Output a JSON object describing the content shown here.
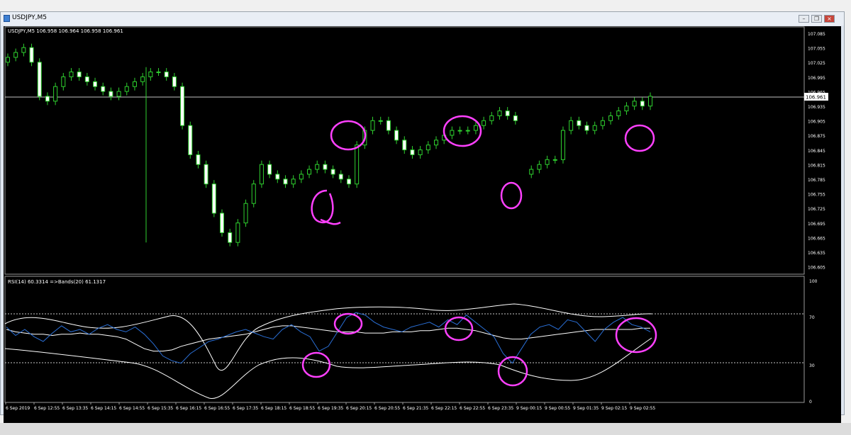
{
  "window": {
    "title": "USDJPY,M5",
    "buttons": [
      "minimize",
      "restore",
      "close"
    ]
  },
  "main_panel": {
    "header": "USDJPY,M5  106.958 106.964 106.958 106.961",
    "price_label": "106.961",
    "price_ticks": [
      "107.085",
      "107.055",
      "107.025",
      "106.995",
      "106.965",
      "106.935",
      "106.905",
      "106.875",
      "106.845",
      "106.815",
      "106.785",
      "106.755",
      "106.725",
      "106.695",
      "106.665",
      "106.635",
      "106.605"
    ]
  },
  "indicator_panel": {
    "header": "RSI(14) 60.3314  =>Bands(20) 61.1317",
    "ticks": [
      "100",
      "70",
      "30",
      "0"
    ]
  },
  "time_axis": [
    "6 Sep 2019",
    "6 Sep 12:55",
    "6 Sep 13:35",
    "6 Sep 14:15",
    "6 Sep 14:55",
    "6 Sep 15:35",
    "6 Sep 16:15",
    "6 Sep 16:55",
    "6 Sep 17:35",
    "6 Sep 18:15",
    "6 Sep 18:55",
    "6 Sep 19:35",
    "6 Sep 20:15",
    "6 Sep 20:55",
    "6 Sep 21:35",
    "6 Sep 22:15",
    "6 Sep 22:55",
    "6 Sep 23:35",
    "9 Sep 00:15",
    "9 Sep 00:55",
    "9 Sep 01:35",
    "9 Sep 02:15",
    "9 Sep 02:55"
  ],
  "chart_data": [
    {
      "type": "candlestick",
      "title": "USDJPY,M5",
      "ylim": [
        106.605,
        107.085
      ],
      "close_approx": [
        107.04,
        107.05,
        107.06,
        107.03,
        106.96,
        106.95,
        106.98,
        107.0,
        107.01,
        107.0,
        106.99,
        106.98,
        106.97,
        106.96,
        106.97,
        106.98,
        106.99,
        107.0,
        107.01,
        107.01,
        107.0,
        106.98,
        106.9,
        106.84,
        106.82,
        106.78,
        106.72,
        106.68,
        106.66,
        106.7,
        106.74,
        106.78,
        106.82,
        106.8,
        106.79,
        106.78,
        106.79,
        106.8,
        106.81,
        106.82,
        106.81,
        106.8,
        106.79,
        106.78,
        106.86,
        106.89,
        106.91,
        106.91,
        106.89,
        106.87,
        106.85,
        106.84,
        106.85,
        106.86,
        106.87,
        106.88,
        106.89,
        106.89,
        106.89,
        106.9,
        106.91,
        106.92,
        106.93,
        106.92,
        106.91,
        106.8,
        106.81,
        106.82,
        106.83,
        106.83,
        106.89,
        106.91,
        106.9,
        106.89,
        106.9,
        106.91,
        106.92,
        106.93,
        106.94,
        106.95,
        106.94,
        106.96
      ],
      "last": 106.961
    },
    {
      "type": "line",
      "title": "RSI(14) 60.3314  =>Bands(20) 61.1317",
      "ylim": [
        0,
        100
      ],
      "levels": [
        70,
        30
      ],
      "series": [
        {
          "name": "RSI(14)",
          "color": "#2a6fd6",
          "values": [
            62,
            55,
            60,
            54,
            50,
            57,
            63,
            58,
            60,
            56,
            61,
            64,
            60,
            58,
            62,
            56,
            48,
            38,
            34,
            32,
            40,
            45,
            50,
            52,
            55,
            58,
            60,
            57,
            54,
            52,
            60,
            64,
            58,
            54,
            42,
            46,
            58,
            70,
            74,
            72,
            66,
            62,
            60,
            58,
            62,
            64,
            66,
            62,
            68,
            64,
            72,
            66,
            60,
            54,
            40,
            32,
            44,
            56,
            62,
            64,
            60,
            68,
            66,
            58,
            50,
            60,
            66,
            70,
            64,
            62,
            58
          ]
        },
        {
          "name": "Bands(20)",
          "color": "#ffffff",
          "values": [
            60,
            58,
            57,
            56,
            56,
            55,
            56,
            56,
            57,
            56,
            56,
            55,
            54,
            52,
            48,
            44,
            42,
            42,
            43,
            46,
            48,
            50,
            52,
            53,
            54,
            55,
            56,
            58,
            60,
            62,
            63,
            63,
            62,
            61,
            60,
            59,
            58,
            58,
            58,
            57,
            57,
            57,
            58,
            58,
            58,
            59,
            59,
            60,
            61,
            61,
            60,
            59,
            57,
            55,
            53,
            52,
            52,
            53,
            54,
            55,
            56,
            57,
            58,
            59,
            60,
            60,
            60,
            60,
            60,
            61,
            61
          ]
        }
      ]
    }
  ]
}
